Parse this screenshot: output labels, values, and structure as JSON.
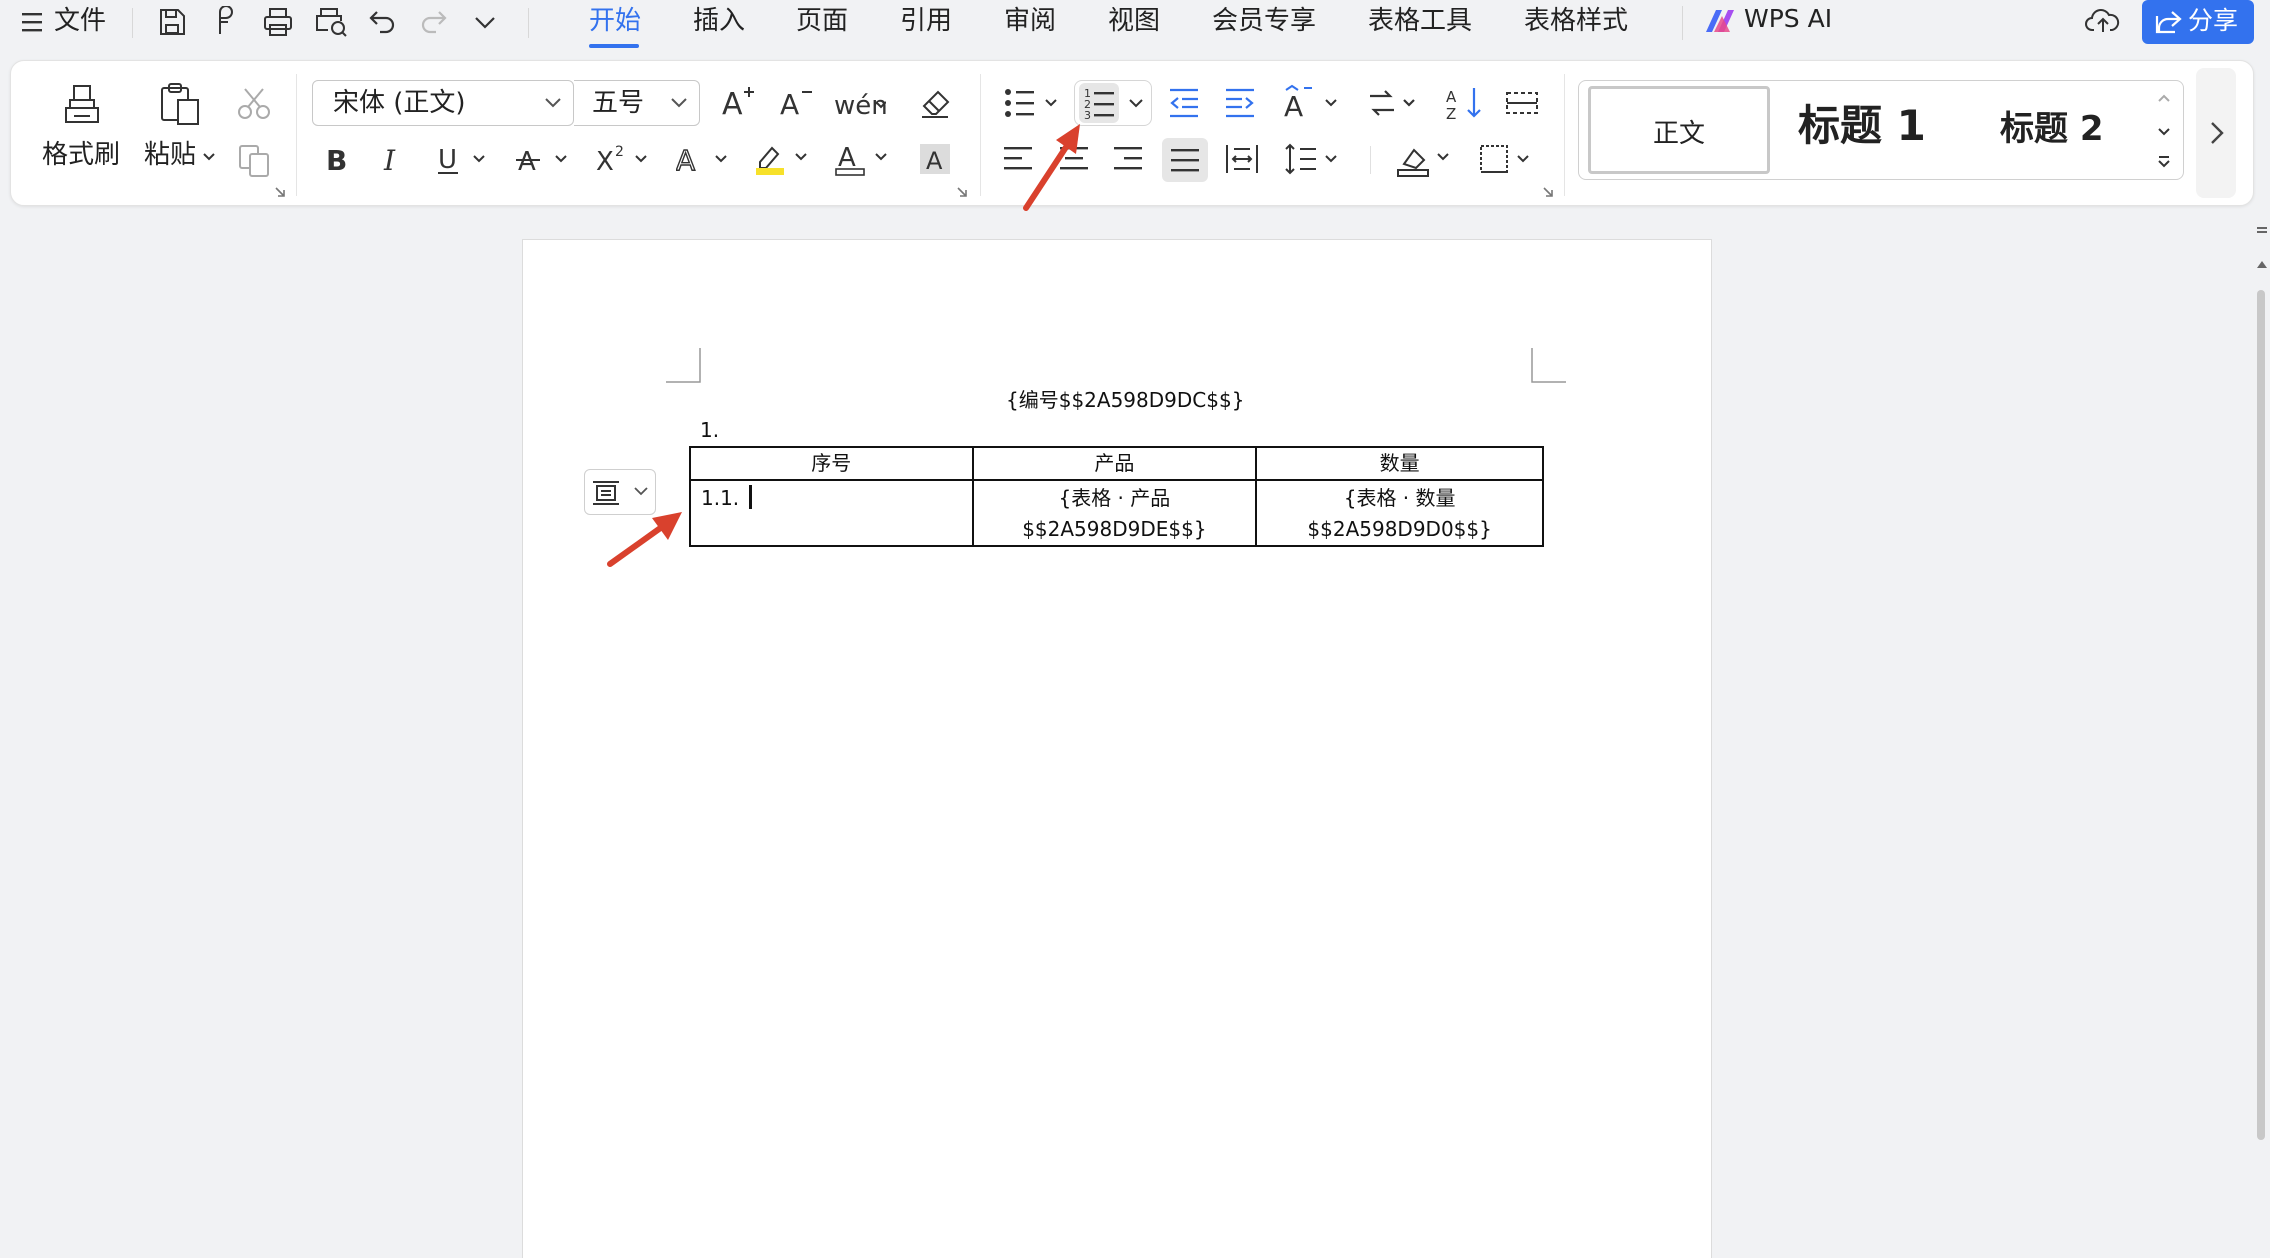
{
  "menu": {
    "file": "文件"
  },
  "tabs": [
    {
      "label": "开始",
      "active": true
    },
    {
      "label": "插入"
    },
    {
      "label": "页面"
    },
    {
      "label": "引用"
    },
    {
      "label": "审阅"
    },
    {
      "label": "视图"
    },
    {
      "label": "会员专享"
    },
    {
      "label": "表格工具"
    },
    {
      "label": "表格样式"
    }
  ],
  "wps_ai": "WPS AI",
  "share": "分享",
  "ribbon": {
    "format_painter": "格式刷",
    "paste": "粘贴",
    "font_name": "宋体 (正文)",
    "font_size": "五号",
    "styles": {
      "normal": "正文",
      "heading1": "标题 1",
      "heading2": "标题 2"
    }
  },
  "document": {
    "header_field": "{编号$$2A598D9DC$$}",
    "list_number": "1.",
    "table": {
      "headers": [
        "序号",
        "产品",
        "数量"
      ],
      "row": [
        "1.1.",
        "{表格 · 产品 $$2A598D9DE$$}",
        "{表格 · 数量 $$2A598D9D0$$}"
      ]
    }
  },
  "colors": {
    "accent": "#3372ee",
    "annotation_arrow": "#d9412d"
  }
}
